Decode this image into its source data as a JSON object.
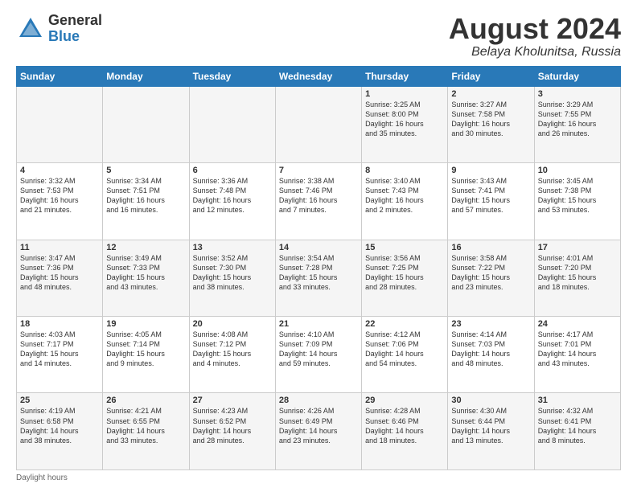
{
  "logo": {
    "general": "General",
    "blue": "Blue"
  },
  "title": "August 2024",
  "location": "Belaya Kholunitsa, Russia",
  "days_of_week": [
    "Sunday",
    "Monday",
    "Tuesday",
    "Wednesday",
    "Thursday",
    "Friday",
    "Saturday"
  ],
  "footer": "Daylight hours",
  "weeks": [
    [
      {
        "day": "",
        "info": ""
      },
      {
        "day": "",
        "info": ""
      },
      {
        "day": "",
        "info": ""
      },
      {
        "day": "",
        "info": ""
      },
      {
        "day": "1",
        "info": "Sunrise: 3:25 AM\nSunset: 8:00 PM\nDaylight: 16 hours\nand 35 minutes."
      },
      {
        "day": "2",
        "info": "Sunrise: 3:27 AM\nSunset: 7:58 PM\nDaylight: 16 hours\nand 30 minutes."
      },
      {
        "day": "3",
        "info": "Sunrise: 3:29 AM\nSunset: 7:55 PM\nDaylight: 16 hours\nand 26 minutes."
      }
    ],
    [
      {
        "day": "4",
        "info": "Sunrise: 3:32 AM\nSunset: 7:53 PM\nDaylight: 16 hours\nand 21 minutes."
      },
      {
        "day": "5",
        "info": "Sunrise: 3:34 AM\nSunset: 7:51 PM\nDaylight: 16 hours\nand 16 minutes."
      },
      {
        "day": "6",
        "info": "Sunrise: 3:36 AM\nSunset: 7:48 PM\nDaylight: 16 hours\nand 12 minutes."
      },
      {
        "day": "7",
        "info": "Sunrise: 3:38 AM\nSunset: 7:46 PM\nDaylight: 16 hours\nand 7 minutes."
      },
      {
        "day": "8",
        "info": "Sunrise: 3:40 AM\nSunset: 7:43 PM\nDaylight: 16 hours\nand 2 minutes."
      },
      {
        "day": "9",
        "info": "Sunrise: 3:43 AM\nSunset: 7:41 PM\nDaylight: 15 hours\nand 57 minutes."
      },
      {
        "day": "10",
        "info": "Sunrise: 3:45 AM\nSunset: 7:38 PM\nDaylight: 15 hours\nand 53 minutes."
      }
    ],
    [
      {
        "day": "11",
        "info": "Sunrise: 3:47 AM\nSunset: 7:36 PM\nDaylight: 15 hours\nand 48 minutes."
      },
      {
        "day": "12",
        "info": "Sunrise: 3:49 AM\nSunset: 7:33 PM\nDaylight: 15 hours\nand 43 minutes."
      },
      {
        "day": "13",
        "info": "Sunrise: 3:52 AM\nSunset: 7:30 PM\nDaylight: 15 hours\nand 38 minutes."
      },
      {
        "day": "14",
        "info": "Sunrise: 3:54 AM\nSunset: 7:28 PM\nDaylight: 15 hours\nand 33 minutes."
      },
      {
        "day": "15",
        "info": "Sunrise: 3:56 AM\nSunset: 7:25 PM\nDaylight: 15 hours\nand 28 minutes."
      },
      {
        "day": "16",
        "info": "Sunrise: 3:58 AM\nSunset: 7:22 PM\nDaylight: 15 hours\nand 23 minutes."
      },
      {
        "day": "17",
        "info": "Sunrise: 4:01 AM\nSunset: 7:20 PM\nDaylight: 15 hours\nand 18 minutes."
      }
    ],
    [
      {
        "day": "18",
        "info": "Sunrise: 4:03 AM\nSunset: 7:17 PM\nDaylight: 15 hours\nand 14 minutes."
      },
      {
        "day": "19",
        "info": "Sunrise: 4:05 AM\nSunset: 7:14 PM\nDaylight: 15 hours\nand 9 minutes."
      },
      {
        "day": "20",
        "info": "Sunrise: 4:08 AM\nSunset: 7:12 PM\nDaylight: 15 hours\nand 4 minutes."
      },
      {
        "day": "21",
        "info": "Sunrise: 4:10 AM\nSunset: 7:09 PM\nDaylight: 14 hours\nand 59 minutes."
      },
      {
        "day": "22",
        "info": "Sunrise: 4:12 AM\nSunset: 7:06 PM\nDaylight: 14 hours\nand 54 minutes."
      },
      {
        "day": "23",
        "info": "Sunrise: 4:14 AM\nSunset: 7:03 PM\nDaylight: 14 hours\nand 48 minutes."
      },
      {
        "day": "24",
        "info": "Sunrise: 4:17 AM\nSunset: 7:01 PM\nDaylight: 14 hours\nand 43 minutes."
      }
    ],
    [
      {
        "day": "25",
        "info": "Sunrise: 4:19 AM\nSunset: 6:58 PM\nDaylight: 14 hours\nand 38 minutes."
      },
      {
        "day": "26",
        "info": "Sunrise: 4:21 AM\nSunset: 6:55 PM\nDaylight: 14 hours\nand 33 minutes."
      },
      {
        "day": "27",
        "info": "Sunrise: 4:23 AM\nSunset: 6:52 PM\nDaylight: 14 hours\nand 28 minutes."
      },
      {
        "day": "28",
        "info": "Sunrise: 4:26 AM\nSunset: 6:49 PM\nDaylight: 14 hours\nand 23 minutes."
      },
      {
        "day": "29",
        "info": "Sunrise: 4:28 AM\nSunset: 6:46 PM\nDaylight: 14 hours\nand 18 minutes."
      },
      {
        "day": "30",
        "info": "Sunrise: 4:30 AM\nSunset: 6:44 PM\nDaylight: 14 hours\nand 13 minutes."
      },
      {
        "day": "31",
        "info": "Sunrise: 4:32 AM\nSunset: 6:41 PM\nDaylight: 14 hours\nand 8 minutes."
      }
    ]
  ]
}
